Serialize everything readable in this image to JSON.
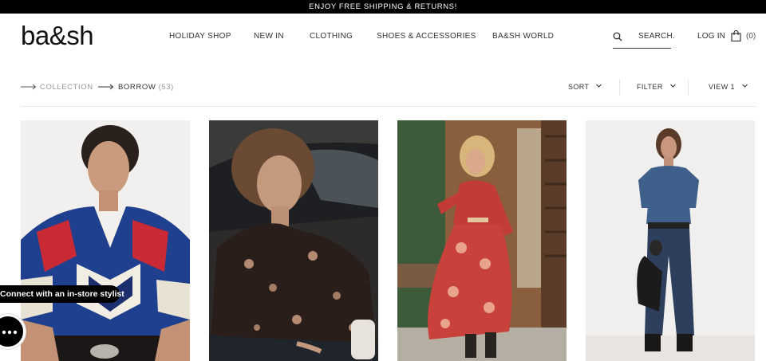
{
  "promo": {
    "text": "ENJOY FREE SHIPPING & RETURNS!"
  },
  "header": {
    "logo": "ba&sh",
    "nav": [
      {
        "label": "HOLIDAY SHOP"
      },
      {
        "label": "NEW IN"
      },
      {
        "label": "CLOTHING"
      },
      {
        "label": "SHOES & ACCESSORIES"
      },
      {
        "label": "BA&SH WORLD"
      }
    ],
    "search_label": "SEARCH.",
    "login_label": "LOG IN",
    "cart_count": "(0)",
    "icons": {
      "search": "search-icon",
      "cart": "shopping-bag-icon"
    }
  },
  "toolbar": {
    "breadcrumb": {
      "collection": "COLLECTION",
      "current": "BORROW",
      "count": "(53)"
    },
    "sort_label": "SORT",
    "filter_label": "FILTER",
    "view_label": "VIEW 1"
  },
  "products": [
    {
      "alt": "Woman in blue and red geometric print blouse"
    },
    {
      "alt": "Woman in dark floral print blouse beside a car"
    },
    {
      "alt": "Woman in red printed maxi dress"
    },
    {
      "alt": "Woman in denim shirt and jeans holding leather jacket"
    }
  ],
  "stylist": {
    "banner": "Connect with an in-store stylist"
  },
  "colors": {
    "promo_bg": "#000000",
    "text": "#222222",
    "muted": "#999999"
  }
}
